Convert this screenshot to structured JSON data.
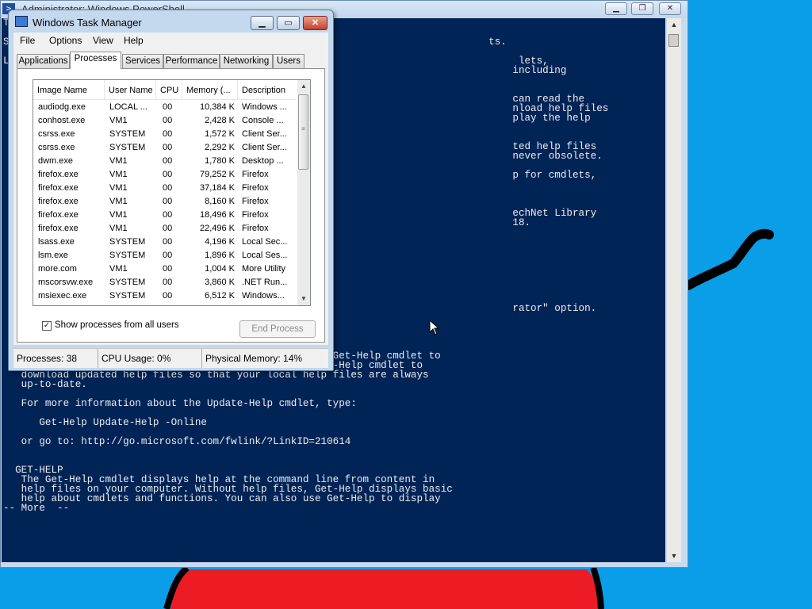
{
  "powershell": {
    "title": "Administrator: Windows PowerShell",
    "console_text": "T\n\nS                                                                                ts.\n\nL                                                                                     lets,\n                                                                                     including\n\n\n                                                                                     can read the\n                                                                                     nload help files\n                                                                                     play the help\n\n\n                                                                                     ted help files\n                                                                                     never obsolete.\n\n                                                                                     p for cmdlets,\n\n\n\n                                                                                     echNet Library\n                                                                                     18.\n\n\n\n\n\n\n\n\n                                                                                     rator\" option.\n\n\n        Update-Help\n\n   After the help files are installed, you can use the Get-Help cmdlet to\n   display the help topics. You can also use the Update-Help cmdlet to\n   download updated help files so that your local help files are always\n   up-to-date.\n\n   For more information about the Update-Help cmdlet, type:\n\n      Get-Help Update-Help -Online\n\n   or go to: http://go.microsoft.com/fwlink/?LinkID=210614\n\n\n  GET-HELP\n   The Get-Help cmdlet displays help at the command line from content in\n   help files on your computer. Without help files, Get-Help displays basic\n   help about cmdlets and functions. You can also use Get-Help to display\n-- More  --"
  },
  "taskmanager": {
    "title": "Windows Task Manager",
    "menu": [
      "File",
      "Options",
      "View",
      "Help"
    ],
    "tabs": [
      "Applications",
      "Processes",
      "Services",
      "Performance",
      "Networking",
      "Users"
    ],
    "active_tab": "Processes",
    "columns": [
      "Image Name",
      "User Name",
      "CPU",
      "Memory (...",
      "Description"
    ],
    "rows": [
      [
        "audiodg.exe",
        "LOCAL ...",
        "00",
        "10,384 K",
        "Windows ..."
      ],
      [
        "conhost.exe",
        "VM1",
        "00",
        "2,428 K",
        "Console ..."
      ],
      [
        "csrss.exe",
        "SYSTEM",
        "00",
        "1,572 K",
        "Client Ser..."
      ],
      [
        "csrss.exe",
        "SYSTEM",
        "00",
        "2,292 K",
        "Client Ser..."
      ],
      [
        "dwm.exe",
        "VM1",
        "00",
        "1,780 K",
        "Desktop ..."
      ],
      [
        "firefox.exe",
        "VM1",
        "00",
        "79,252 K",
        "Firefox"
      ],
      [
        "firefox.exe",
        "VM1",
        "00",
        "37,184 K",
        "Firefox"
      ],
      [
        "firefox.exe",
        "VM1",
        "00",
        "8,160 K",
        "Firefox"
      ],
      [
        "firefox.exe",
        "VM1",
        "00",
        "18,496 K",
        "Firefox"
      ],
      [
        "firefox.exe",
        "VM1",
        "00",
        "22,496 K",
        "Firefox"
      ],
      [
        "lsass.exe",
        "SYSTEM",
        "00",
        "4,196 K",
        "Local Sec..."
      ],
      [
        "lsm.exe",
        "SYSTEM",
        "00",
        "1,896 K",
        "Local Ses..."
      ],
      [
        "more.com",
        "VM1",
        "00",
        "1,004 K",
        "More Utility"
      ],
      [
        "mscorsvw.exe",
        "SYSTEM",
        "00",
        "3,860 K",
        ".NET Run..."
      ],
      [
        "msiexec.exe",
        "SYSTEM",
        "00",
        "6,512 K",
        "Windows..."
      ]
    ],
    "show_all_users_label": "Show processes from all users",
    "show_all_users_checked": true,
    "end_process_label": "End Process",
    "status": {
      "processes": "Processes: 38",
      "cpu": "CPU Usage: 0%",
      "memory": "Physical Memory: 14%"
    }
  },
  "colors": {
    "desktop": "#0a9ee8",
    "console_bg": "#012456",
    "console_fg": "#eeedf0"
  }
}
